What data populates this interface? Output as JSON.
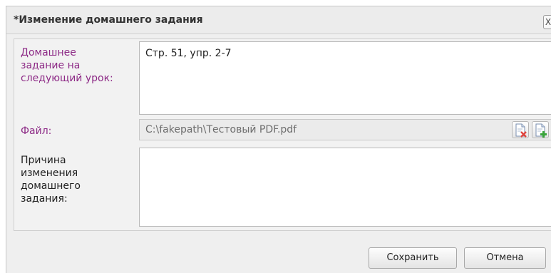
{
  "dialog": {
    "title": "*Изменение домашнего задания",
    "close_label": "X"
  },
  "form": {
    "homework": {
      "label_lines": [
        "Домашнее",
        "задание на",
        "следующий урок:"
      ],
      "value": "Стр. 51, упр. 2-7"
    },
    "file": {
      "label": "Файл:",
      "value": "C:\\fakepath\\Тестовый PDF.pdf"
    },
    "reason": {
      "label_lines": [
        "Причина",
        "изменения",
        "домашнего",
        "задания:"
      ],
      "value": ""
    }
  },
  "buttons": {
    "save": "Сохранить",
    "cancel": "Отмена"
  },
  "colors": {
    "accent_label": "#8d2a86",
    "remove_icon": "#e0413a",
    "add_icon": "#3aa53a"
  },
  "icons": {
    "remove_file": "file-remove-icon",
    "add_file": "file-add-icon"
  }
}
